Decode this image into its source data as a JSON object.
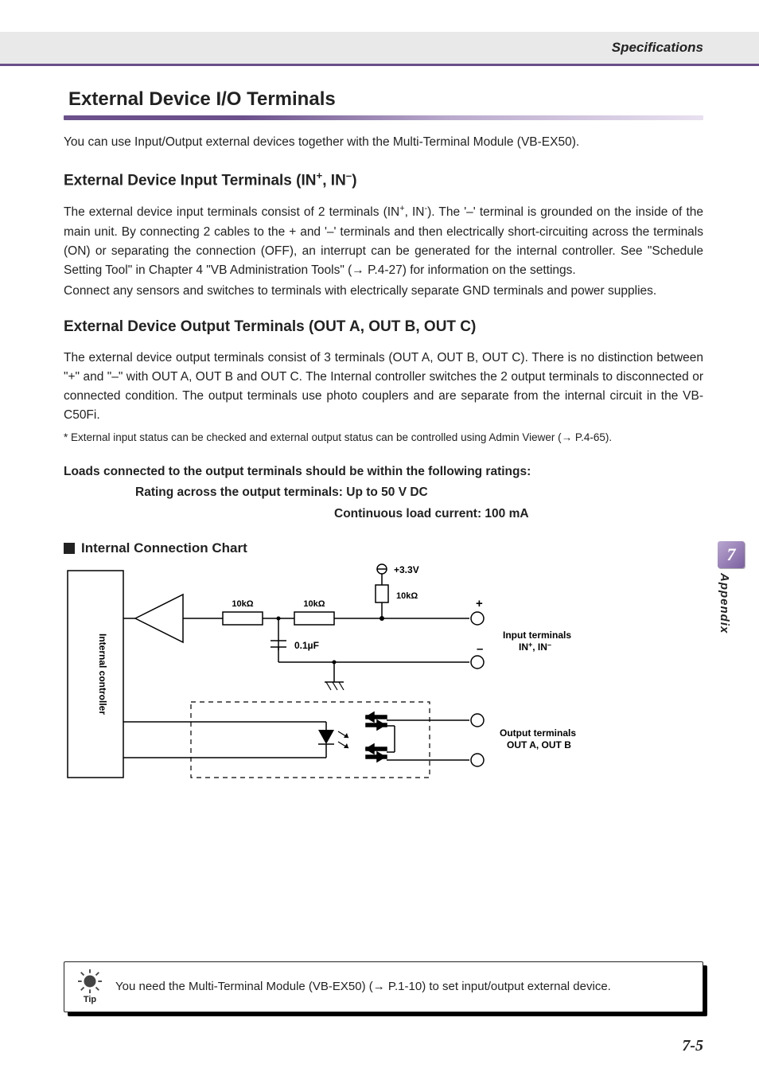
{
  "header": {
    "breadcrumb": "Specifications"
  },
  "section": {
    "title": "External Device I/O Terminals",
    "intro": "You can use Input/Output external devices together with the Multi-Terminal Module (VB-EX50)."
  },
  "input_terminals": {
    "heading_prefix": "External Device Input Terminals (IN",
    "heading_mid": ", IN",
    "heading_suffix": ")",
    "para1_a": "The external device input terminals consist of 2 terminals (IN",
    "para1_b": ", IN",
    "para1_c": "). The '–' terminal is grounded on the inside of the main unit. By connecting 2 cables to the + and '–' terminals and then electrically short-circuiting across the terminals (ON) or separating the connection (OFF), an interrupt can be generated for the internal controller. See \"Schedule Setting Tool\" in Chapter 4 \"VB Administration Tools\" (→ P.4-27) for information on the settings.",
    "para2": "Connect any sensors and switches to terminals with electrically separate GND terminals and power supplies."
  },
  "output_terminals": {
    "heading": "External Device Output Terminals (OUT A, OUT B, OUT C)",
    "para": "The external device output terminals consist of 3 terminals (OUT A, OUT B, OUT C). There is no distinction between \"+\" and \"–\" with OUT A, OUT B and OUT C. The Internal controller switches the 2 output terminals to disconnected or connected condition. The output terminals use photo couplers and are separate from the internal circuit in the VB-C50Fi.",
    "note": "* External input status can be checked and external output status can be controlled using Admin Viewer (→ P.4-65)."
  },
  "ratings": {
    "line1": "Loads connected to the output terminals should be within the following ratings:",
    "line2": "Rating across the output terminals: Up to 50 V DC",
    "line3": "Continuous load current: 100 mA"
  },
  "chart": {
    "heading": "Internal Connection Chart",
    "labels": {
      "controller": "Internal controller",
      "v33": "+3.3V",
      "r10k_1": "10kΩ",
      "r10k_2": "10kΩ",
      "r10k_3": "10kΩ",
      "cap": "0.1µF",
      "plus": "+",
      "minus": "–",
      "input_title": "Input terminals",
      "input_sub_a": "IN",
      "input_sub_b": ", IN",
      "output_title": "Output terminals",
      "output_sub": "OUT A, OUT B"
    }
  },
  "tip": {
    "label": "Tip",
    "text": "You need the Multi-Terminal Module (VB-EX50) (→ P.1-10) to set input/output external device."
  },
  "sidetab": {
    "num": "7",
    "label": "Appendix"
  },
  "pagenum": "7-5"
}
